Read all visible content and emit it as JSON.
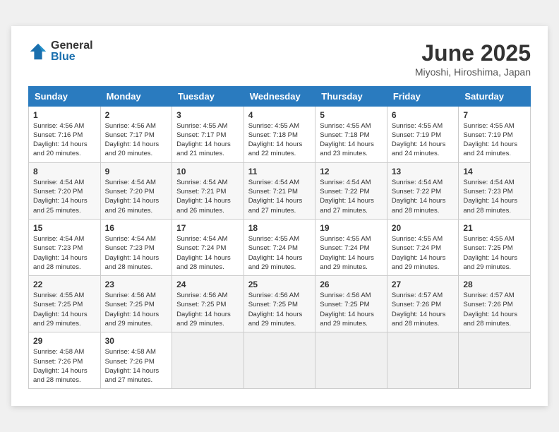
{
  "logo": {
    "general": "General",
    "blue": "Blue"
  },
  "title": "June 2025",
  "location": "Miyoshi, Hiroshima, Japan",
  "headers": [
    "Sunday",
    "Monday",
    "Tuesday",
    "Wednesday",
    "Thursday",
    "Friday",
    "Saturday"
  ],
  "weeks": [
    [
      {
        "day": "1",
        "sunrise": "4:56 AM",
        "sunset": "7:16 PM",
        "daylight": "14 hours and 20 minutes."
      },
      {
        "day": "2",
        "sunrise": "4:56 AM",
        "sunset": "7:17 PM",
        "daylight": "14 hours and 20 minutes."
      },
      {
        "day": "3",
        "sunrise": "4:55 AM",
        "sunset": "7:17 PM",
        "daylight": "14 hours and 21 minutes."
      },
      {
        "day": "4",
        "sunrise": "4:55 AM",
        "sunset": "7:18 PM",
        "daylight": "14 hours and 22 minutes."
      },
      {
        "day": "5",
        "sunrise": "4:55 AM",
        "sunset": "7:18 PM",
        "daylight": "14 hours and 23 minutes."
      },
      {
        "day": "6",
        "sunrise": "4:55 AM",
        "sunset": "7:19 PM",
        "daylight": "14 hours and 24 minutes."
      },
      {
        "day": "7",
        "sunrise": "4:55 AM",
        "sunset": "7:19 PM",
        "daylight": "14 hours and 24 minutes."
      }
    ],
    [
      {
        "day": "8",
        "sunrise": "4:54 AM",
        "sunset": "7:20 PM",
        "daylight": "14 hours and 25 minutes."
      },
      {
        "day": "9",
        "sunrise": "4:54 AM",
        "sunset": "7:20 PM",
        "daylight": "14 hours and 26 minutes."
      },
      {
        "day": "10",
        "sunrise": "4:54 AM",
        "sunset": "7:21 PM",
        "daylight": "14 hours and 26 minutes."
      },
      {
        "day": "11",
        "sunrise": "4:54 AM",
        "sunset": "7:21 PM",
        "daylight": "14 hours and 27 minutes."
      },
      {
        "day": "12",
        "sunrise": "4:54 AM",
        "sunset": "7:22 PM",
        "daylight": "14 hours and 27 minutes."
      },
      {
        "day": "13",
        "sunrise": "4:54 AM",
        "sunset": "7:22 PM",
        "daylight": "14 hours and 28 minutes."
      },
      {
        "day": "14",
        "sunrise": "4:54 AM",
        "sunset": "7:23 PM",
        "daylight": "14 hours and 28 minutes."
      }
    ],
    [
      {
        "day": "15",
        "sunrise": "4:54 AM",
        "sunset": "7:23 PM",
        "daylight": "14 hours and 28 minutes."
      },
      {
        "day": "16",
        "sunrise": "4:54 AM",
        "sunset": "7:23 PM",
        "daylight": "14 hours and 28 minutes."
      },
      {
        "day": "17",
        "sunrise": "4:54 AM",
        "sunset": "7:24 PM",
        "daylight": "14 hours and 28 minutes."
      },
      {
        "day": "18",
        "sunrise": "4:55 AM",
        "sunset": "7:24 PM",
        "daylight": "14 hours and 29 minutes."
      },
      {
        "day": "19",
        "sunrise": "4:55 AM",
        "sunset": "7:24 PM",
        "daylight": "14 hours and 29 minutes."
      },
      {
        "day": "20",
        "sunrise": "4:55 AM",
        "sunset": "7:24 PM",
        "daylight": "14 hours and 29 minutes."
      },
      {
        "day": "21",
        "sunrise": "4:55 AM",
        "sunset": "7:25 PM",
        "daylight": "14 hours and 29 minutes."
      }
    ],
    [
      {
        "day": "22",
        "sunrise": "4:55 AM",
        "sunset": "7:25 PM",
        "daylight": "14 hours and 29 minutes."
      },
      {
        "day": "23",
        "sunrise": "4:56 AM",
        "sunset": "7:25 PM",
        "daylight": "14 hours and 29 minutes."
      },
      {
        "day": "24",
        "sunrise": "4:56 AM",
        "sunset": "7:25 PM",
        "daylight": "14 hours and 29 minutes."
      },
      {
        "day": "25",
        "sunrise": "4:56 AM",
        "sunset": "7:25 PM",
        "daylight": "14 hours and 29 minutes."
      },
      {
        "day": "26",
        "sunrise": "4:56 AM",
        "sunset": "7:25 PM",
        "daylight": "14 hours and 29 minutes."
      },
      {
        "day": "27",
        "sunrise": "4:57 AM",
        "sunset": "7:26 PM",
        "daylight": "14 hours and 28 minutes."
      },
      {
        "day": "28",
        "sunrise": "4:57 AM",
        "sunset": "7:26 PM",
        "daylight": "14 hours and 28 minutes."
      }
    ],
    [
      {
        "day": "29",
        "sunrise": "4:58 AM",
        "sunset": "7:26 PM",
        "daylight": "14 hours and 28 minutes."
      },
      {
        "day": "30",
        "sunrise": "4:58 AM",
        "sunset": "7:26 PM",
        "daylight": "14 hours and 27 minutes."
      },
      null,
      null,
      null,
      null,
      null
    ]
  ],
  "labels": {
    "sunrise": "Sunrise:",
    "sunset": "Sunset:",
    "daylight": "Daylight:"
  }
}
